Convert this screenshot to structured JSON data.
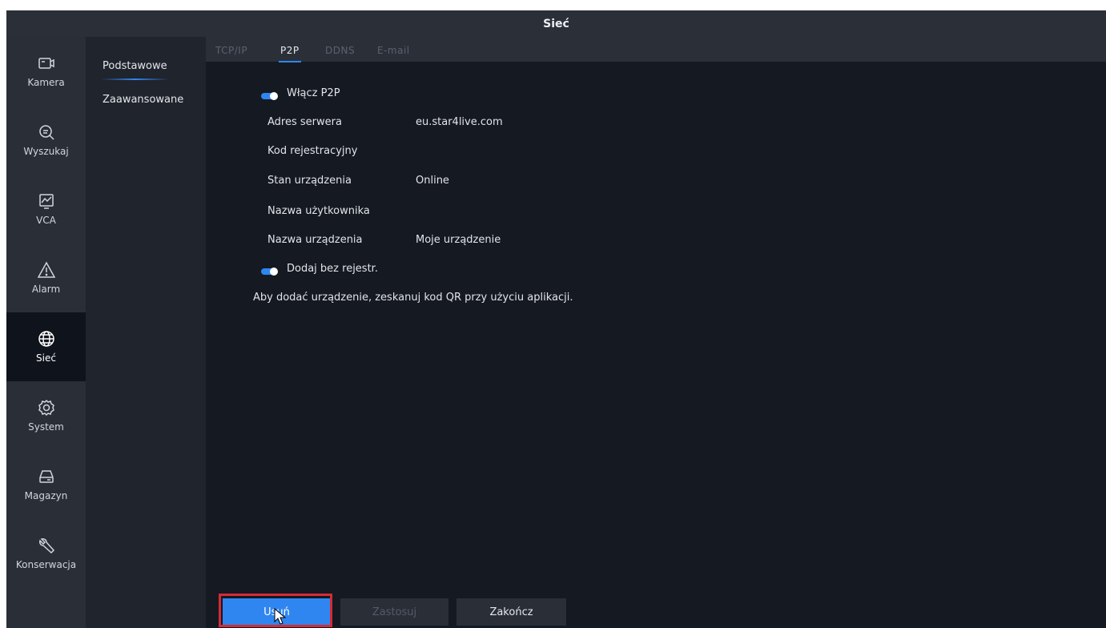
{
  "window": {
    "title": "Sieć"
  },
  "sidebar": {
    "items": [
      {
        "label": "Kamera",
        "icon": "camera-icon",
        "active": false
      },
      {
        "label": "Wyszukaj",
        "icon": "search-icon",
        "active": false
      },
      {
        "label": "VCA",
        "icon": "vca-icon",
        "active": false
      },
      {
        "label": "Alarm",
        "icon": "alarm-icon",
        "active": false
      },
      {
        "label": "Sieć",
        "icon": "globe-icon",
        "active": true
      },
      {
        "label": "System",
        "icon": "gear-icon",
        "active": false
      },
      {
        "label": "Magazyn",
        "icon": "hdd-icon",
        "active": false
      },
      {
        "label": "Konserwacja",
        "icon": "wrench-icon",
        "active": false
      }
    ]
  },
  "submenu": {
    "items": [
      {
        "label": "Podstawowe",
        "active": true
      },
      {
        "label": "Zaawansowane",
        "active": false
      }
    ]
  },
  "tabs": [
    {
      "label": "TCP/IP",
      "active": false
    },
    {
      "label": "P2P",
      "active": true
    },
    {
      "label": "DDNS",
      "active": false
    },
    {
      "label": "E-mail",
      "active": false
    }
  ],
  "p2p": {
    "enable_label": "Włącz P2P",
    "enable_on": true,
    "fields": [
      {
        "label": "Adres serwera",
        "value": "eu.star4live.com"
      },
      {
        "label": "Kod rejestracyjny",
        "value": ""
      },
      {
        "label": "Stan urządzenia",
        "value": "Online"
      },
      {
        "label": "Nazwa użytkownika",
        "value": ""
      },
      {
        "label": "Nazwa urządzenia",
        "value": "Moje urządzenie"
      }
    ],
    "add_label": "Dodaj bez rejestr.",
    "add_on": true,
    "hint": "Aby dodać urządzenie, zeskanuj kod QR przy użyciu aplikacji."
  },
  "footer": {
    "delete_label": "Usuń",
    "apply_label": "Zastosuj",
    "exit_label": "Zakończ"
  },
  "colors": {
    "accent": "#2f86f1",
    "background": "#151922",
    "sidebar": "#2a2e37",
    "highlight": "#d52b35"
  }
}
